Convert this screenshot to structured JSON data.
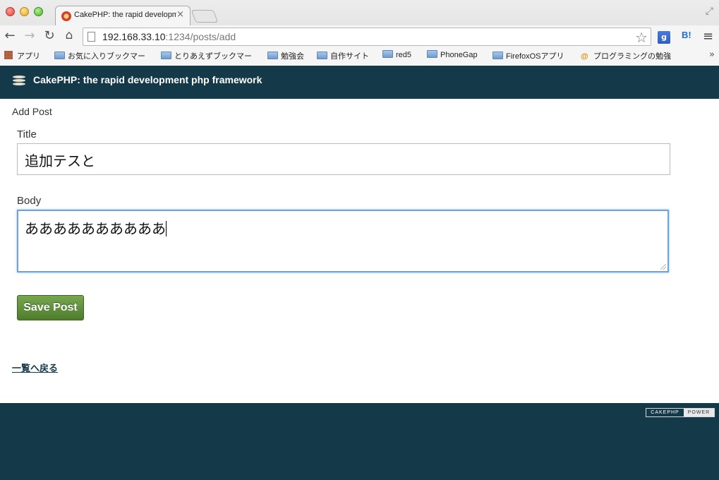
{
  "browser": {
    "tab_title": "CakePHP: the rapid development php framework",
    "tab_close": "×",
    "url_host": "192.168.33.10",
    "url_rest": ":1234/posts/add",
    "ext_google": "g",
    "ext_hatena": "B!",
    "bookmarks": [
      {
        "label": "アプリ",
        "icon": "apps-icon"
      },
      {
        "label": "お気に入りブックマー",
        "icon": "folder-icon"
      },
      {
        "label": "とりあえずブックマー",
        "icon": "folder-icon"
      },
      {
        "label": "勉強会",
        "icon": "folder-icon"
      },
      {
        "label": "自作サイト",
        "icon": "folder-icon"
      },
      {
        "label": "red5",
        "icon": "folder-icon"
      },
      {
        "label": "PhoneGap",
        "icon": "folder-icon"
      },
      {
        "label": "FirefoxOSアプリ",
        "icon": "folder-icon"
      },
      {
        "label": "プログラミングの勉強",
        "icon": "at-icon"
      }
    ],
    "bookmarks_more": "»"
  },
  "header": {
    "title": "CakePHP: the rapid development php framework"
  },
  "form": {
    "heading": "Add Post",
    "title_label": "Title",
    "title_value": "追加テスと",
    "body_label": "Body",
    "body_value": "ああああああああああ",
    "submit_label": "Save Post"
  },
  "back_link": "一覧へ戻る",
  "footer": {
    "power_left": "CAKEPHP",
    "power_right": "POWER"
  },
  "colors": {
    "header_bg": "#143948",
    "button_green": "#5e8f3a",
    "focus_blue": "#6da5d8"
  }
}
